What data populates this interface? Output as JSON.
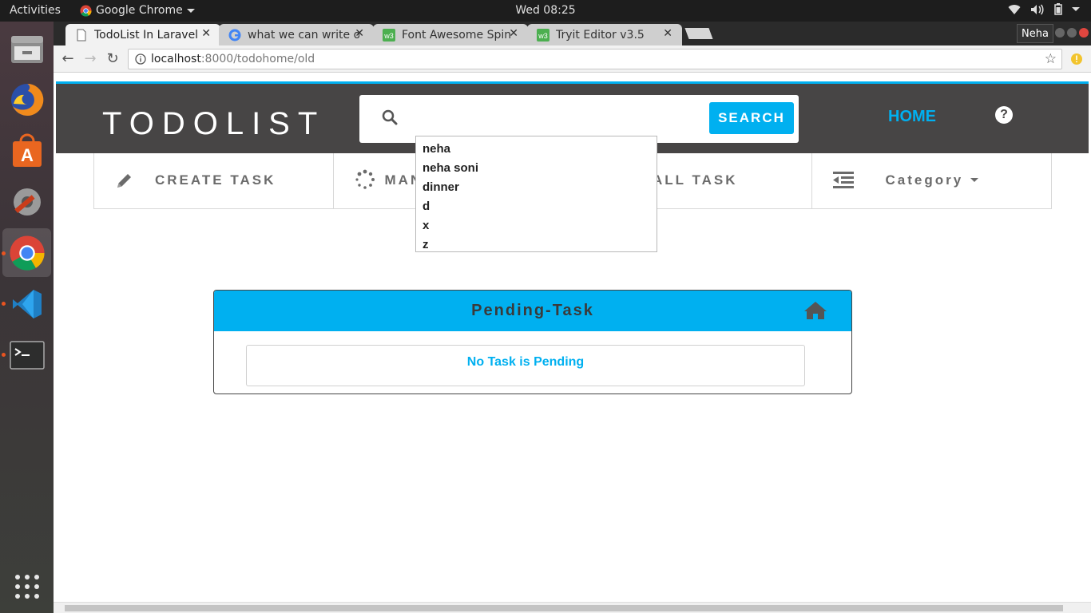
{
  "topbar": {
    "activities": "Activities",
    "app_name": "Google Chrome",
    "clock": "Wed 08:25"
  },
  "dock": {
    "items": [
      "files-icon",
      "firefox-icon",
      "software-center-icon",
      "settings-icon",
      "chrome-icon",
      "vscode-icon",
      "terminal-icon",
      "app-grid-icon"
    ]
  },
  "browser": {
    "tabs": [
      {
        "title": "TodoList In Laravel"
      },
      {
        "title": "what we can write o"
      },
      {
        "title": "Font Awesome Spin"
      },
      {
        "title": "Tryit Editor v3.5"
      }
    ],
    "profile": "Neha",
    "url_host": "localhost",
    "url_path": ":8000/todohome/old"
  },
  "app": {
    "brand": "TODOLIST",
    "search_button": "SEARCH",
    "search_value": "",
    "home_link": "HOME",
    "help": "?",
    "menu": {
      "create": "CREATE TASK",
      "manage": "MAN",
      "all": "ALL TASK",
      "category": "Category"
    },
    "autocomplete": [
      "neha",
      "neha soni",
      "dinner",
      "d",
      "x",
      "z"
    ],
    "panel": {
      "title": "Pending-Task",
      "empty": "No Task is Pending"
    }
  },
  "colors": {
    "accent": "#00b0f0",
    "navbar": "#474545"
  }
}
